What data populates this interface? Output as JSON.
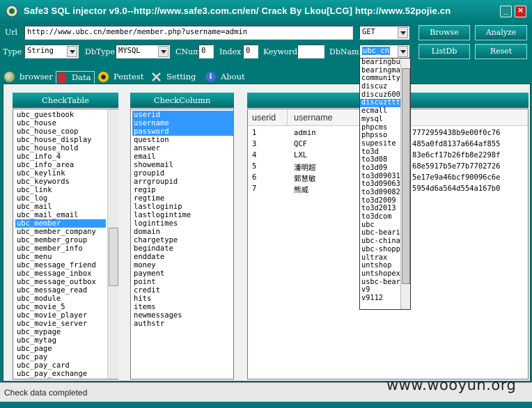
{
  "window": {
    "title": "Safe3 SQL injector v9.0--http://www.safe3.com.cn/en/        Crack  By  Lkou[LCG]     http://www.52pojie.cn",
    "min_label": "_",
    "close_label": "×"
  },
  "toolbar": {
    "url_label": "Url",
    "url_value": "http://www.ubc.cn/member/member.php?username=admin",
    "method_value": "GET",
    "type_label": "Type",
    "type_value": "String",
    "dbtype_label": "DbType",
    "dbtype_value": "MYSQL",
    "cnum_label": "CNum",
    "cnum_value": "0",
    "index_label": "Index",
    "index_value": "0",
    "keyword_label": "Keyword",
    "keyword_value": "",
    "dbname_label": "DbName",
    "dbname_value": "ubc_cn",
    "browse_label": "Browse",
    "analyze_label": "Analyze",
    "listdb_label": "ListDb",
    "reset_label": "Reset"
  },
  "tabs": [
    {
      "label": "browser",
      "icon": "globe-icon"
    },
    {
      "label": "Data",
      "icon": "database-icon"
    },
    {
      "label": "Pentest",
      "icon": "hazard-icon"
    },
    {
      "label": "Setting",
      "icon": "tools-icon"
    },
    {
      "label": "About",
      "icon": "info-icon"
    }
  ],
  "check_table": {
    "header": "CheckTable",
    "items": [
      "ubc_guestbook",
      "ubc_house",
      "ubc_house_coop",
      "ubc_house_display",
      "ubc_house_hold",
      "ubc_info_4",
      "ubc_info_area",
      "ubc_keylink",
      "ubc_keywords",
      "ubc_link",
      "ubc_log",
      "ubc_mail",
      "ubc_mail_email",
      "ubc_member",
      "ubc_member_company",
      "ubc_member_group",
      "ubc_member_info",
      "ubc_menu",
      "ubc_message_friend",
      "ubc_message_inbox",
      "ubc_message_outbox",
      "ubc_message_read",
      "ubc_module",
      "ubc_movie_5",
      "ubc_movie_player",
      "ubc_movie_server",
      "ubc_mypage",
      "ubc_mytag",
      "ubc_page",
      "ubc_pay",
      "ubc_pay_card",
      "ubc_pay_exchange"
    ],
    "selected": "ubc_member"
  },
  "check_column": {
    "header": "CheckColumn",
    "items": [
      "userid",
      "username",
      "password",
      "question",
      "answer",
      "email",
      "showemail",
      "groupid",
      "arrgroupid",
      "regip",
      "regtime",
      "lastloginip",
      "lastlogintime",
      "logintimes",
      "domain",
      "chargetype",
      "begindate",
      "enddate",
      "money",
      "payment",
      "point",
      "credit",
      "hits",
      "items",
      "newmessages",
      "authstr"
    ],
    "selected": [
      "userid",
      "username",
      "password"
    ]
  },
  "result_grid": {
    "columns": [
      "userid",
      "username"
    ],
    "rows": [
      {
        "userid": "1",
        "username": "admin",
        "password_tail": "7772959438b9e00f0c76"
      },
      {
        "userid": "3",
        "username": "QCF",
        "password_tail": "485a0fd8137a664af855"
      },
      {
        "userid": "4",
        "username": "LXL",
        "password_tail": "83e6cf17b26fb8e2298f"
      },
      {
        "userid": "5",
        "username": "潘明超",
        "password_tail": "68e5917b5e77b7702726"
      },
      {
        "userid": "6",
        "username": "郭慧敏",
        "password_tail": "5e17e9a46bcf90096c6e"
      },
      {
        "userid": "7",
        "username": "熊威",
        "password_tail": "5954d6a564d554a167b0"
      }
    ]
  },
  "dbname_dropdown": {
    "options": [
      "bearingbu",
      "bearingma",
      "community",
      "discuz",
      "discuz600",
      "discuzttt",
      "ecmall",
      "mysql",
      "phpcms",
      "phpsso",
      "supesite",
      "to3d",
      "to3d08",
      "to3d09",
      "to3d09031",
      "to3d09063",
      "to3d09082",
      "to3d2009",
      "to3d2013",
      "to3dcom",
      "ubc",
      "ubc-beari",
      "ubc-china",
      "ubc-shopp",
      "ultrax",
      "untshop",
      "untshopex",
      "usbc-bear",
      "v9",
      "v9112"
    ],
    "highlighted": "discuzttt"
  },
  "status": {
    "text": "Check data completed",
    "watermark": "www.wooyun.org"
  },
  "colors": {
    "accent": "#007878",
    "selection": "#3399ff",
    "close": "#c42020"
  }
}
